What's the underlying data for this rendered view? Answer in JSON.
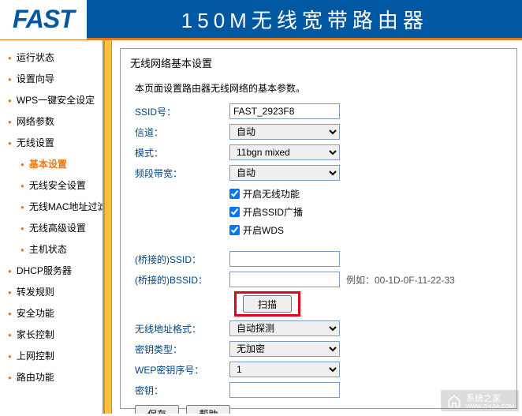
{
  "header": {
    "logo": "FAST",
    "title": "150M无线宽带路由器"
  },
  "sidebar": {
    "items": [
      {
        "label": "运行状态",
        "sub": false
      },
      {
        "label": "设置向导",
        "sub": false
      },
      {
        "label": "WPS一键安全设定",
        "sub": false
      },
      {
        "label": "网络参数",
        "sub": false
      },
      {
        "label": "无线设置",
        "sub": false
      },
      {
        "label": "基本设置",
        "sub": true,
        "active": true
      },
      {
        "label": "无线安全设置",
        "sub": true
      },
      {
        "label": "无线MAC地址过滤",
        "sub": true
      },
      {
        "label": "无线高级设置",
        "sub": true
      },
      {
        "label": "主机状态",
        "sub": true
      },
      {
        "label": "DHCP服务器",
        "sub": false
      },
      {
        "label": "转发规则",
        "sub": false
      },
      {
        "label": "安全功能",
        "sub": false
      },
      {
        "label": "家长控制",
        "sub": false
      },
      {
        "label": "上网控制",
        "sub": false
      },
      {
        "label": "路由功能",
        "sub": false
      }
    ]
  },
  "panel": {
    "title": "无线网络基本设置",
    "description": "本页面设置路由器无线网络的基本参数。",
    "fields": {
      "ssid_label": "SSID号：",
      "ssid_value": "FAST_2923F8",
      "channel_label": "信道：",
      "channel_value": "自动",
      "mode_label": "模式：",
      "mode_value": "11bgn mixed",
      "bandwidth_label": "频段带宽：",
      "bandwidth_value": "自动",
      "enable_wireless": "开启无线功能",
      "enable_ssid_broadcast": "开启SSID广播",
      "enable_wds": "开启WDS",
      "bridge_ssid_label": "(桥接的)SSID：",
      "bridge_ssid_value": "",
      "bridge_bssid_label": "(桥接的)BSSID：",
      "bridge_bssid_value": "",
      "bridge_bssid_hint": "例如：00-1D-0F-11-22-33",
      "scan_label": "扫描",
      "addr_format_label": "无线地址格式：",
      "addr_format_value": "自动探测",
      "key_type_label": "密钥类型：",
      "key_type_value": "无加密",
      "wep_index_label": "WEP密钥序号：",
      "wep_index_value": "1",
      "key_label": "密钥：",
      "key_value": ""
    },
    "actions": {
      "save": "保存",
      "help": "帮助"
    }
  },
  "watermark": {
    "text": "系统之家",
    "url": "WWW.ZHIJIA.COM"
  }
}
